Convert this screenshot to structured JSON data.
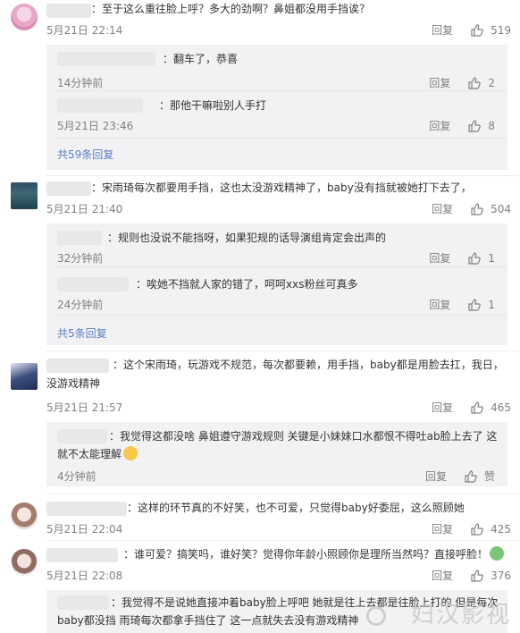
{
  "reply_label": "回复",
  "comments": [
    {
      "text": "：至于这么重往脸上呼？多大的劲啊？鼻姐都没用手挡诶？",
      "time": "5月21日 22:14",
      "likes": "519",
      "replies": [
        {
          "text": "：翻车了，恭喜",
          "time": "14分钟前",
          "likes": "2"
        },
        {
          "text": "：那他干嘛啦别人手打",
          "time": "5月21日 23:46",
          "likes": "8"
        }
      ],
      "more": "共59条回复"
    },
    {
      "text": "：宋雨琦每次都要用手挡，这也太没游戏精神了，baby没有挡就被她打下去了，",
      "time": "5月21日 21:40",
      "likes": "504",
      "replies": [
        {
          "text": "：规则也没说不能挡呀，如果犯规的话导演组肯定会出声的",
          "time": "32分钟前",
          "likes": "1"
        },
        {
          "text": "：唉她不挡就人家的错了，呵呵xxs粉丝可真多",
          "time": "24分钟前",
          "likes": "1"
        }
      ],
      "more": "共5条回复"
    },
    {
      "text": "：这个宋雨琦，玩游戏不规范，每次都要赖，用手挡，baby都是用脸去扛，我日，没游戏精神",
      "time": "5月21日 21:57",
      "likes": "465",
      "replies": [
        {
          "text": "：我觉得这都没啥 鼻姐遵守游戏规则 关键是小妹妹口水都恨不得吐ab脸上去了 这就不太能理解",
          "time": "4分钟前",
          "likes": "赞"
        }
      ]
    },
    {
      "text": "：这样的环节真的不好笑，也不可爱，只觉得baby好委屈，这么照顾她",
      "time": "5月21日 22:04",
      "likes": "425"
    },
    {
      "text": "：谁可爱？搞笑吗，谁好笑？觉得你年龄小照顾你是理所当然吗？直接呼脸！",
      "time": "5月21日 22:08",
      "likes": "376",
      "replies": [
        {
          "text": "：我觉得不是说她直接冲着baby脸上呼吧 她就是往上去都是往脸上打的 但是每次baby都没挡 雨琦每次都拿手挡住了 这一点就失去没有游戏精神"
        }
      ]
    }
  ],
  "watermark": "妇汉影视"
}
